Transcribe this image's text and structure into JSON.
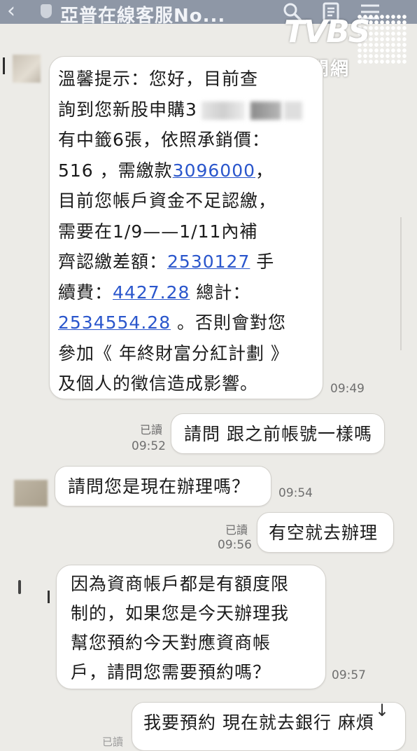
{
  "header": {
    "back_icon": "chevron-left-icon",
    "title": "亞普在線客服No...",
    "icons": [
      "search-icon",
      "note-icon",
      "menu-icon"
    ]
  },
  "watermark": {
    "logo": "TVBS",
    "subtitle": "新聞網"
  },
  "messages": [
    {
      "side": "left",
      "lines": [
        [
          {
            "t": "溫馨提示：您好，目前查"
          }
        ],
        [
          {
            "t": "詢到您新股申購3"
          },
          {
            "blur": "blur1"
          },
          {
            "blur": "blur2"
          },
          {
            "blur": "blur3"
          }
        ],
        [
          {
            "t": "有中籤6張，依照承銷價："
          }
        ],
        [
          {
            "t": "516 ，需繳款"
          },
          {
            "t": "3096000",
            "link": true
          },
          {
            "t": "，"
          }
        ],
        [
          {
            "t": "目前您帳戶資金不足認繳，"
          }
        ],
        [
          {
            "t": "需要在1/9——1/11內補"
          }
        ],
        [
          {
            "t": "齊認繳差額："
          },
          {
            "t": "2530127",
            "link": true
          },
          {
            "t": " 手"
          }
        ],
        [
          {
            "t": "續費："
          },
          {
            "t": "4427.28",
            "link": true
          },
          {
            "t": " 總計："
          }
        ],
        [
          {
            "t": "2534554.28",
            "link": true
          },
          {
            "t": " 。否則會對您"
          }
        ],
        [
          {
            "t": "參加《 年終財富分紅計劃 》"
          }
        ],
        [
          {
            "t": "及個人的徵信造成影響。"
          }
        ]
      ],
      "time": "09:49"
    },
    {
      "side": "right",
      "text": "請問 跟之前帳號一樣嗎",
      "read": "已讀",
      "time": "09:52"
    },
    {
      "side": "left",
      "text": "請問您是現在辦理嗎？",
      "time": "09:54"
    },
    {
      "side": "right",
      "text": "有空就去辦理",
      "read": "已讀",
      "time": "09:56"
    },
    {
      "side": "left",
      "lines": [
        "因為資商帳戶都是有額度限",
        "制的，如果您是今天辦理我",
        "幫您預約今天對應資商帳",
        "戶，請問您需要預約嗎？"
      ],
      "time": "09:57"
    },
    {
      "side": "right",
      "text": "我要預約 現在就去銀行 麻煩",
      "read": "已讀"
    }
  ],
  "colors": {
    "background": "#ecebe7",
    "header": "#8e97a6",
    "link": "#2a56cc"
  }
}
